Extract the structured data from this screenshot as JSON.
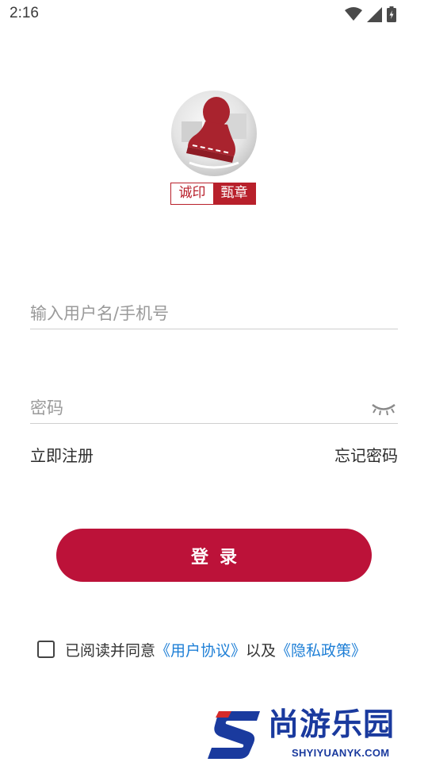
{
  "status_bar": {
    "time": "2:16",
    "icons": [
      "wifi-icon",
      "signal-icon",
      "battery-charging-icon"
    ]
  },
  "logo": {
    "badge_left": "诚印",
    "badge_right": "甄章",
    "brand_color": "#b8202b"
  },
  "login_form": {
    "username_placeholder": "输入用户名/手机号",
    "password_placeholder": "密码",
    "register_label": "立即注册",
    "forgot_label": "忘记密码",
    "login_label": "登录",
    "login_color": "#bc1239"
  },
  "agreement": {
    "prefix": "已阅读并同意",
    "user_agreement": "《用户协议》",
    "connector": "以及",
    "privacy_policy": "《隐私政策》",
    "checked": false,
    "link_color": "#1e7fd6"
  },
  "watermark": {
    "name": "尚游乐园",
    "url": "SHYIYUANYK.COM"
  }
}
